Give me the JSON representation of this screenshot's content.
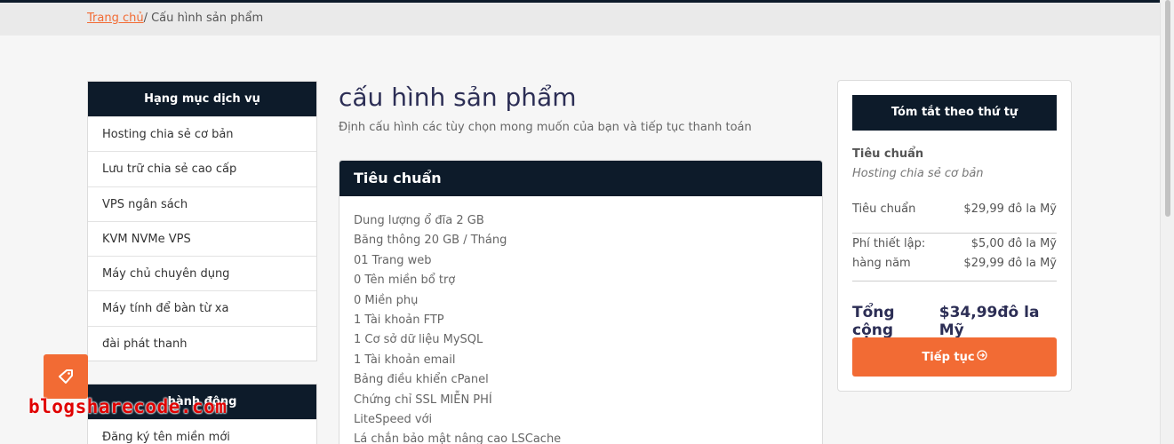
{
  "breadcrumb": {
    "home": "Trang chủ",
    "separator": "/ ",
    "current": "Cấu hình sản phẩm"
  },
  "sidebar": {
    "categories_title": "Hạng mục dịch vụ",
    "categories": [
      "Hosting chia sẻ cơ bản",
      "Lưu trữ chia sẻ cao cấp",
      "VPS ngân sách",
      "KVM NVMe VPS",
      "Máy chủ chuyên dụng",
      "Máy tính để bàn từ xa",
      "đài phát thanh"
    ],
    "actions_title": "hành động",
    "actions": [
      "Đăng ký tên miền mới"
    ]
  },
  "main": {
    "title": "cấu hình sản phẩm",
    "subtitle": "Định cấu hình các tùy chọn mong muốn của bạn và tiếp tục thanh toán",
    "product": {
      "name": "Tiêu chuẩn",
      "features": [
        "Dung lượng ổ đĩa 2 GB",
        "Băng thông 20 GB / Tháng",
        "01 Trang web",
        "0 Tên miền bổ trợ",
        "0 Miền phụ",
        "1 Tài khoản FTP",
        "1 Cơ sở dữ liệu MySQL",
        "1 Tài khoản email",
        "Bảng điều khiển cPanel",
        "Chứng chỉ SSL MIỄN PHÍ",
        "LiteSpeed với",
        "Lá chắn bảo mật nâng cao LSCache"
      ]
    }
  },
  "summary": {
    "title": "Tóm tắt theo thứ tự",
    "product_name": "Tiêu chuẩn",
    "product_group": "Hosting chia sẻ cơ bản",
    "line_label": "Tiêu chuẩn",
    "line_price": "$29,99 đô la Mỹ",
    "setup_label": "Phí thiết lập:",
    "setup_price": "$5,00 đô la Mỹ",
    "recurring_label": "hàng năm",
    "recurring_price": "$29,99 đô la Mỹ",
    "total_label": "Tổng cộng",
    "total_value": "$34,99đô la Mỹ",
    "checkout_label": "Tiếp tục"
  },
  "watermark": "blogsharecode.com",
  "colors": {
    "navy": "#0d1b2a",
    "accent": "#f26b34",
    "title": "#2c2e55"
  },
  "icons": {
    "fab": "tag-icon",
    "checkout": "arrow-circle-right-icon"
  }
}
